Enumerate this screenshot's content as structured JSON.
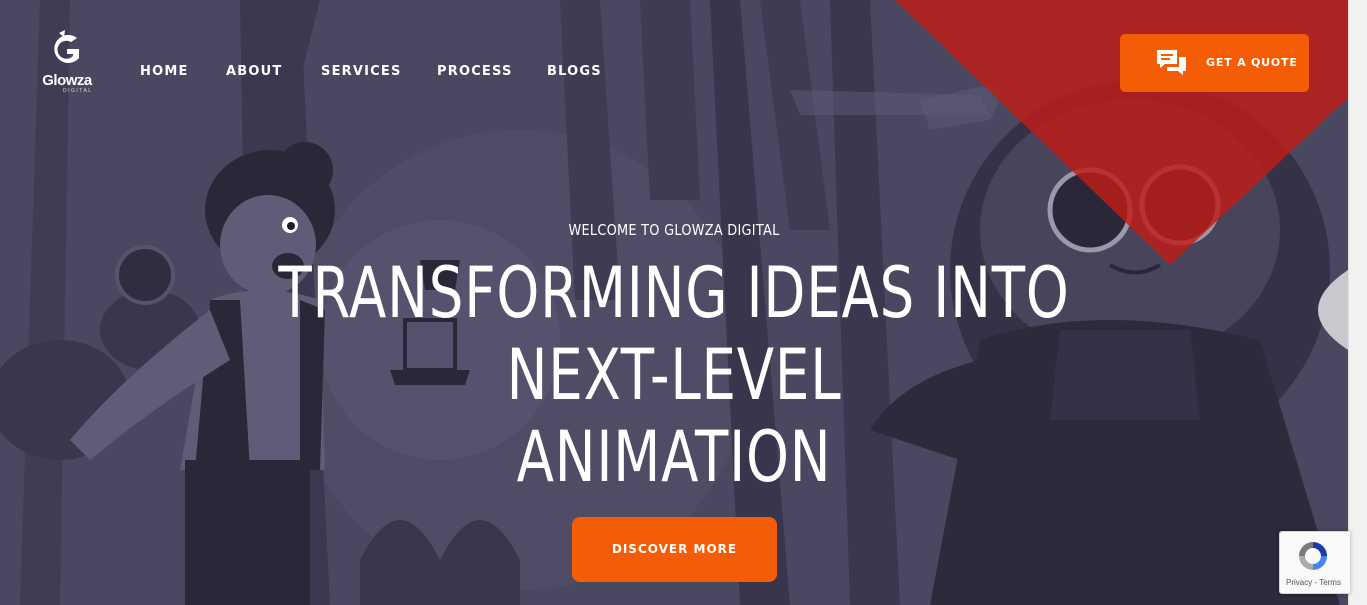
{
  "brand": {
    "logo_text": "Glowza",
    "logo_sub": "DIGITAL"
  },
  "nav": {
    "items": [
      {
        "label": "HOME"
      },
      {
        "label": "ABOUT"
      },
      {
        "label": "SERVICES"
      },
      {
        "label": "PROCESS"
      },
      {
        "label": "BLOGS"
      }
    ]
  },
  "cta": {
    "quote_label": "GET A QUOTE",
    "quote_icon": "chat-bubbles-icon"
  },
  "hero": {
    "welcome": "WELCOME TO GLOWZA DIGITAL",
    "headline_lines": [
      "TRANSFORMING IDEAS INTO",
      "NEXT-LEVEL",
      "ANIMATION"
    ],
    "discover_label": "DISCOVER MORE"
  },
  "recaptcha": {
    "links": "Privacy - Terms",
    "icon": "recaptcha-icon"
  },
  "colors": {
    "accent": "#f45c06",
    "accent_triangle": "#c01c16",
    "background": "#47445a"
  }
}
